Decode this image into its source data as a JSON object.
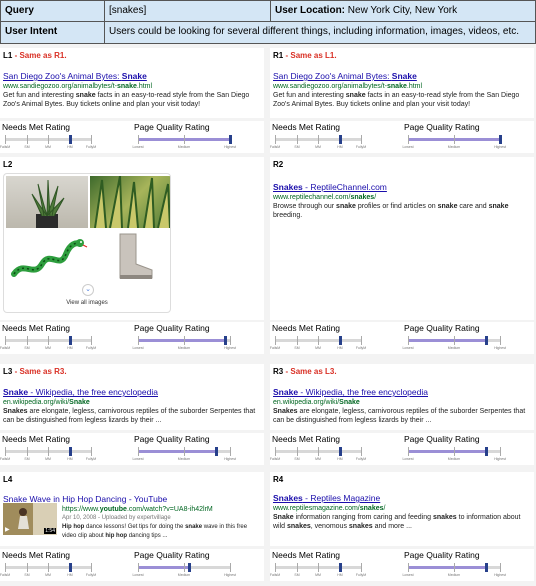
{
  "header": {
    "query_label": "Query",
    "query_value": "[snakes]",
    "location_label": "User Location:",
    "location_value": "New York City, New York",
    "intent_label": "User Intent",
    "intent_value": "Users could be looking for several different things, including information, images, videos, etc."
  },
  "rating": {
    "needs_met_label": "Needs Met Rating",
    "page_quality_label": "Page Quality Rating",
    "needs_met_ticks": [
      "FailsM",
      "SM",
      "MM",
      "HM",
      "FullyM"
    ],
    "page_quality_ticks": [
      "Lowest",
      "Medium",
      "Highest"
    ]
  },
  "panels": {
    "L1": {
      "id": "L1",
      "same_as": "- Same as R1.",
      "title_prefix": "San Diego Zoo's Animal Bytes: ",
      "title_bold": "Snake",
      "url_prefix": "www.sandiegozoo.org/animalbytes/t-",
      "url_bold": "snake",
      "url_suffix": ".html",
      "snippet_1": "Get fun and interesting ",
      "snippet_b1": "snake",
      "snippet_2": " facts in an easy-to-read style from the San Diego Zoo's Animal Bytes. Buy tickets online and plan your visit today!",
      "needs_met": 0.75,
      "page_quality": 1.0
    },
    "R1": {
      "id": "R1",
      "same_as": "- Same as L1.",
      "title_prefix": "San Diego Zoo's Animal Bytes: ",
      "title_bold": "Snake",
      "url_prefix": "www.sandiegozoo.org/animalbytes/t-",
      "url_bold": "snake",
      "url_suffix": ".html",
      "snippet_1": "Get fun and interesting ",
      "snippet_b1": "snake",
      "snippet_2": " facts in an easy-to-read style from the San Diego Zoo's Animal Bytes. Buy tickets online and plan your visit today!",
      "needs_met": 0.75,
      "page_quality": 1.0
    },
    "L2": {
      "id": "L2",
      "view_all": "View all images",
      "needs_met": 0.75,
      "page_quality": 0.95
    },
    "R2": {
      "id": "R2",
      "title_bold": "Snakes",
      "title_suffix": " - ReptileChannel.com",
      "url_prefix": "www.reptilechannel.com/",
      "url_bold": "snakes",
      "url_suffix": "/",
      "snippet_1": "Browse through our ",
      "snippet_b1": "snake",
      "snippet_2": " profiles or find articles on ",
      "snippet_b2": "snake",
      "snippet_3": " care and ",
      "snippet_b3": "snake",
      "snippet_4": " breeding.",
      "needs_met": 0.75,
      "page_quality": 0.85
    },
    "L3": {
      "id": "L3",
      "same_as": "- Same as R3.",
      "title_bold": "Snake",
      "title_suffix": " - Wikipedia, the free encyclopedia",
      "url_prefix": "en.wikipedia.org/wiki/",
      "url_bold": "Snake",
      "snippet_b1": "Snakes",
      "snippet_1": " are elongate, legless, carnivorous reptiles of the suborder Serpentes that can be distinguished from legless lizards by their ...",
      "needs_met": 0.75,
      "page_quality": 0.85
    },
    "R3": {
      "id": "R3",
      "same_as": "- Same as L3.",
      "title_bold": "Snake",
      "title_suffix": " - Wikipedia, the free encyclopedia",
      "url_prefix": "en.wikipedia.org/wiki/",
      "url_bold": "Snake",
      "snippet_b1": "Snakes",
      "snippet_1": " are elongate, legless, carnivorous reptiles of the suborder Serpentes that can be distinguished from legless lizards by their ...",
      "needs_met": 0.75,
      "page_quality": 0.85
    },
    "L4": {
      "id": "L4",
      "title": "Snake Wave in Hip Hop Dancing - YouTube",
      "url_prefix": "https://www.",
      "url_bold": "youtube",
      "url_suffix": ".com/watch?v=UA8-ih42lrM",
      "meta": "Apr 10, 2008 - Uploaded by expertvillage",
      "snippet_b1": "Hip hop",
      "snippet_1": " dance lessons! Get tips for doing the ",
      "snippet_b2": "snake",
      "snippet_2": " wave in this free video clip about ",
      "snippet_b3": "hip hop",
      "snippet_3": " dancing tips ...",
      "video_time": "1:54",
      "needs_met": 0.75,
      "page_quality": 0.55
    },
    "R4": {
      "id": "R4",
      "title_bold": "Snakes",
      "title_suffix": " - Reptiles Magazine",
      "url_prefix": "www.reptilesmagazine.com/",
      "url_bold": "snakes",
      "url_suffix": "/",
      "snippet_b1": "Snake",
      "snippet_1": " information ranging from caring and feeding ",
      "snippet_b2": "snakes",
      "snippet_2": " to information about wild ",
      "snippet_b3": "snakes",
      "snippet_3": ", venomous ",
      "snippet_b4": "snakes",
      "snippet_4": " and more ...",
      "needs_met": 0.75,
      "page_quality": 0.85
    }
  },
  "colors": {
    "header_bg": "#d4e6f5",
    "link": "#1a0dab",
    "url": "#006621",
    "same_as": "#d93025",
    "knob": "#27408b",
    "fill": "#9b8fd6"
  }
}
